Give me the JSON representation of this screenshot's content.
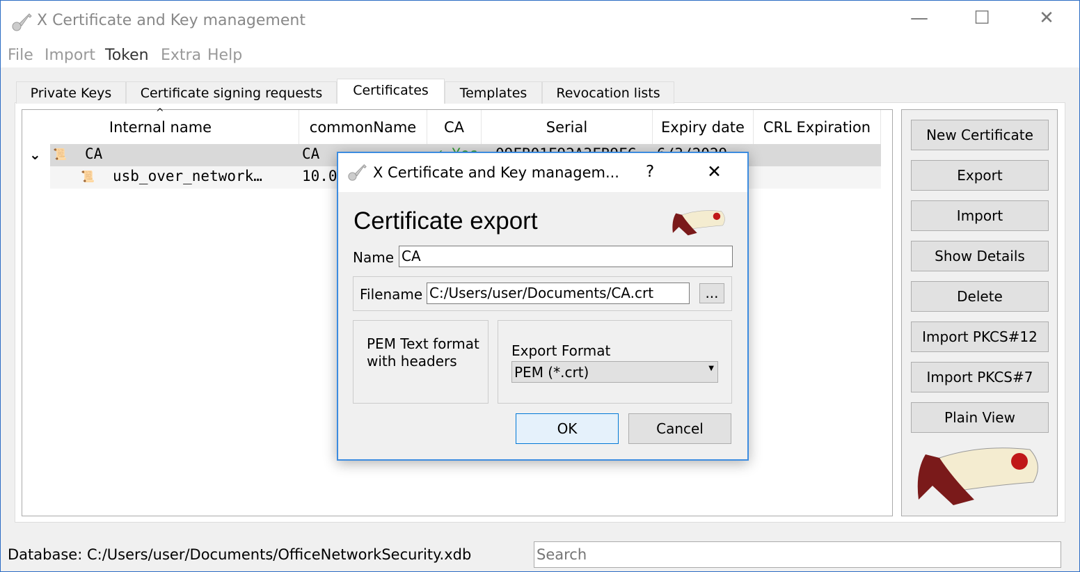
{
  "window": {
    "title": "X Certificate and Key management",
    "minimize": "—",
    "maximize": "☐",
    "close": "✕"
  },
  "menu": [
    "File",
    "Import",
    "Token",
    "Extra",
    "Help"
  ],
  "tabs": [
    "Private Keys",
    "Certificate signing requests",
    "Certificates",
    "Templates",
    "Revocation lists"
  ],
  "active_tab": "Certificates",
  "table": {
    "sort_indicator": "^",
    "columns": [
      "Internal name",
      "commonName",
      "CA",
      "Serial",
      "Expiry date",
      "CRL Expiration"
    ],
    "rows": [
      {
        "expander": "⌄",
        "internal_name": "CA",
        "common_name": "CA",
        "ca": "✓ Yes",
        "serial": "09FB01F92A3FB9FC",
        "expiry": "6/3/2029",
        "crl": ""
      },
      {
        "internal_name": "usb_over_network…",
        "common_name": "10.0",
        "ca": "",
        "serial": "",
        "expiry": "",
        "crl": ""
      }
    ]
  },
  "buttons": [
    "New Certificate",
    "Export",
    "Import",
    "Show Details",
    "Delete",
    "Import PKCS#12",
    "Import PKCS#7",
    "Plain View"
  ],
  "status": {
    "database": "Database: C:/Users/user/Documents/OfficeNetworkSecurity.xdb",
    "search_placeholder": "Search"
  },
  "dialog": {
    "title": "X Certificate and Key managem...",
    "help": "?",
    "close": "✕",
    "heading": "Certificate export",
    "name_label": "Name",
    "name_value": "CA",
    "filename_label": "Filename",
    "filename_value": "C:/Users/user/Documents/CA.crt",
    "browse": "...",
    "description": "PEM Text format with headers",
    "format_label": "Export Format",
    "format_value": "PEM (*.crt)",
    "ok": "OK",
    "cancel": "Cancel"
  },
  "colors": {
    "accent": "#3c8ce0",
    "selected_row": "#d9d9d9",
    "ok_bg": "#e5f1fb"
  }
}
